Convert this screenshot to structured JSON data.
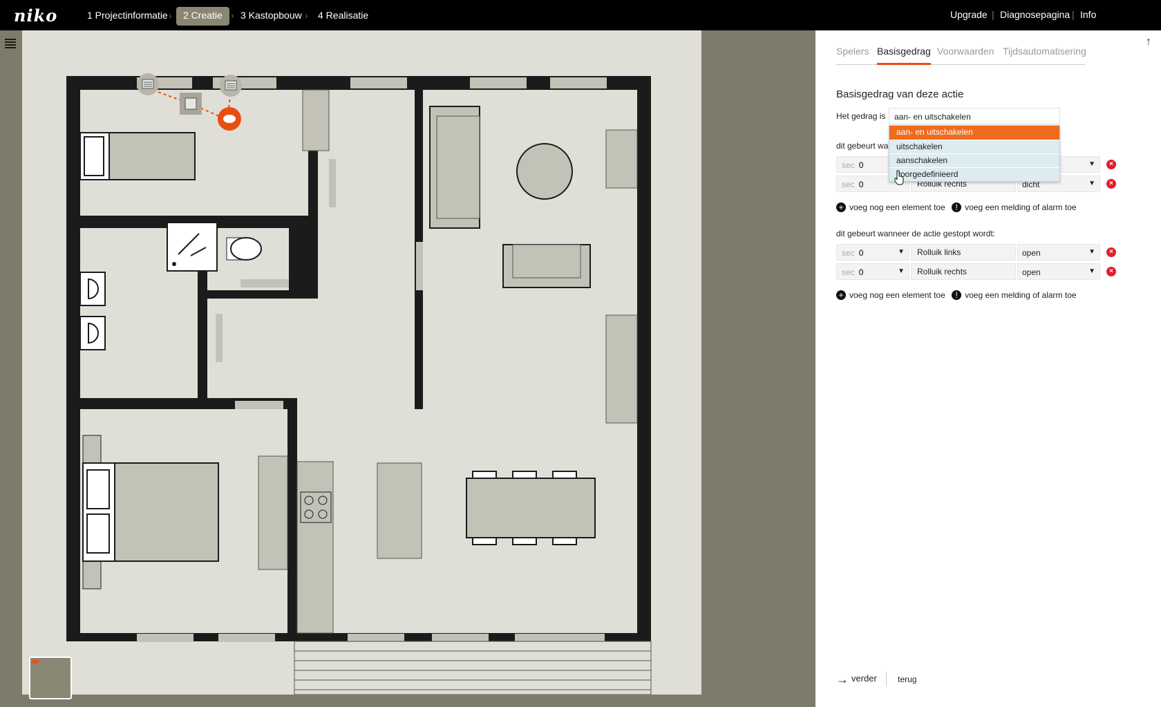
{
  "app": {
    "logo": "niko"
  },
  "steps": [
    {
      "label": "1 Projectinformatie"
    },
    {
      "label": "2 Creatie"
    },
    {
      "label": "3 Kastopbouw"
    },
    {
      "label": "4 Realisatie"
    }
  ],
  "toplinks": {
    "upgrade": "Upgrade",
    "diagnose": "Diagnosepagina",
    "info": "Info",
    "separator": "|"
  },
  "panel": {
    "tabs": [
      "Spelers",
      "Basisgedrag",
      "Voorwaarden",
      "Tijdsautomatisering"
    ],
    "section_title": "Basisgedrag van deze actie",
    "behavior_label": "Het gedrag is",
    "behavior_value": "aan- en uitschakelen",
    "behavior_options": [
      "aan- en uitschakelen",
      "uitschakelen",
      "aanschakelen",
      "voorgedefinieerd"
    ],
    "started_label": "dit gebeurt wa",
    "sec_unit": "sec",
    "started_rows": [
      {
        "sec": "0",
        "element": "",
        "state": ""
      },
      {
        "sec": "0",
        "element": "Rolluik rechts",
        "state": "dicht"
      }
    ],
    "add_element": "voeg nog een element toe",
    "add_alarm": "voeg een melding of alarm toe",
    "stopped_label": "dit gebeurt wanneer de actie gestopt wordt:",
    "stopped_rows": [
      {
        "sec": "0",
        "element": "Rolluik links",
        "state": "open"
      },
      {
        "sec": "0",
        "element": "Rolluik rechts",
        "state": "open"
      }
    ],
    "next_label": "verder",
    "back_label": "terug"
  },
  "colors": {
    "accent": "#e94e0f",
    "topbar": "#000000",
    "panel_bg": "#ffffff",
    "floor": "#dfdfd8",
    "furniture": "#c3c2b7",
    "wall": "#1b1b1b"
  }
}
